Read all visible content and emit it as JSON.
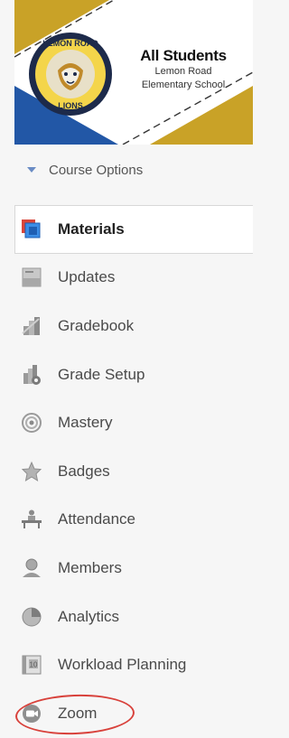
{
  "banner": {
    "title": "All Students",
    "school_line1": "Lemon Road",
    "school_line2": "Elementary School",
    "logo_top_text": "LEMON ROAD",
    "logo_bottom_text": "LIONS",
    "colors": {
      "gold": "#c9a227",
      "blue": "#2257a6",
      "navy": "#1d2a4a"
    }
  },
  "course_options": {
    "label": "Course Options"
  },
  "nav": {
    "items": [
      {
        "label": "Materials",
        "icon": "materials-icon",
        "active": true
      },
      {
        "label": "Updates",
        "icon": "updates-icon"
      },
      {
        "label": "Gradebook",
        "icon": "gradebook-icon"
      },
      {
        "label": "Grade Setup",
        "icon": "grade-setup-icon"
      },
      {
        "label": "Mastery",
        "icon": "mastery-icon"
      },
      {
        "label": "Badges",
        "icon": "badges-icon"
      },
      {
        "label": "Attendance",
        "icon": "attendance-icon"
      },
      {
        "label": "Members",
        "icon": "members-icon"
      },
      {
        "label": "Analytics",
        "icon": "analytics-icon"
      },
      {
        "label": "Workload Planning",
        "icon": "workload-planning-icon"
      },
      {
        "label": "Zoom",
        "icon": "zoom-icon",
        "highlighted": true
      }
    ]
  },
  "highlight_color": "#d8413b"
}
